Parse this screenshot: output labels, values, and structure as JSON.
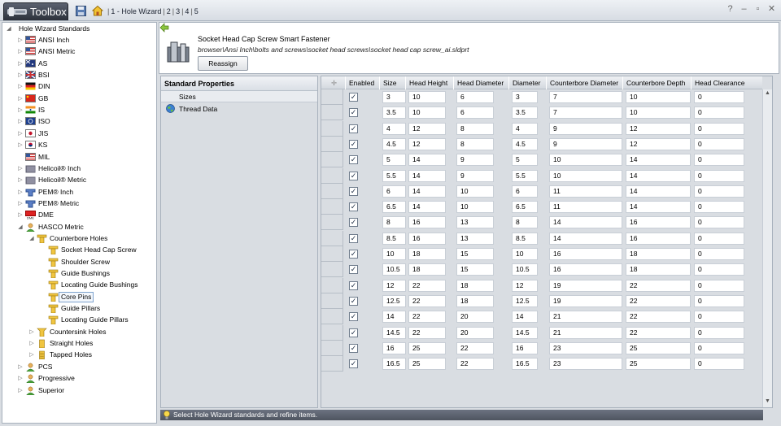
{
  "app": {
    "title": "Toolbox"
  },
  "breadcrumb": {
    "items": [
      "1 - Hole Wizard",
      "2",
      "3",
      "4",
      "5"
    ]
  },
  "window_buttons": [
    "?",
    "–",
    "▫",
    "✕"
  ],
  "tree": {
    "root": "Hole Wizard Standards",
    "nodes": [
      {
        "label": "ANSI Inch",
        "icon": "flag-usa-icon"
      },
      {
        "label": "ANSI Metric",
        "icon": "flag-usa-icon"
      },
      {
        "label": "AS",
        "icon": "flag-australia-icon"
      },
      {
        "label": "BSI",
        "icon": "flag-uk-icon"
      },
      {
        "label": "DIN",
        "icon": "flag-germany-icon"
      },
      {
        "label": "GB",
        "icon": "flag-china-icon"
      },
      {
        "label": "IS",
        "icon": "flag-india-icon"
      },
      {
        "label": "ISO",
        "icon": "flag-iso-icon"
      },
      {
        "label": "JIS",
        "icon": "flag-japan-icon"
      },
      {
        "label": "KS",
        "icon": "flag-korea-icon"
      },
      {
        "label": "MIL",
        "icon": "flag-usa-icon"
      },
      {
        "label": "Helicoil® Inch",
        "icon": "helicoil-icon"
      },
      {
        "label": "Helicoil® Metric",
        "icon": "helicoil-icon"
      },
      {
        "label": "PEM® Inch",
        "icon": "pem-icon"
      },
      {
        "label": "PEM® Metric",
        "icon": "pem-icon"
      },
      {
        "label": "DME",
        "icon": "dme-icon"
      },
      {
        "label": "HASCO Metric",
        "icon": "user-group-icon"
      },
      {
        "label": "Counterbore Holes",
        "icon": "counterbore-icon"
      },
      {
        "label": "Socket Head Cap Screw",
        "icon": "counterbore-icon"
      },
      {
        "label": "Shoulder Screw",
        "icon": "counterbore-icon"
      },
      {
        "label": "Guide Bushings",
        "icon": "counterbore-icon"
      },
      {
        "label": "Locating Guide Bushings",
        "icon": "counterbore-icon"
      },
      {
        "label": "Core Pins",
        "icon": "counterbore-icon"
      },
      {
        "label": "Guide Pillars",
        "icon": "counterbore-icon"
      },
      {
        "label": "Locating Guide Pillars",
        "icon": "counterbore-icon"
      },
      {
        "label": "Countersink Holes",
        "icon": "countersink-icon"
      },
      {
        "label": "Straight Holes",
        "icon": "straight-hole-icon"
      },
      {
        "label": "Tapped Holes",
        "icon": "tapped-hole-icon"
      },
      {
        "label": "PCS",
        "icon": "user-group-icon"
      },
      {
        "label": "Progressive",
        "icon": "user-group-icon"
      },
      {
        "label": "Superior",
        "icon": "user-group-icon"
      }
    ]
  },
  "header": {
    "title": "Socket Head Cap Screw Smart Fastener",
    "path": "browser\\Ansi Inch\\bolts and screws\\socket head screws\\socket head cap screw_ai.sldprt",
    "reassign_label": "Reassign"
  },
  "props": {
    "title": "Standard Properties",
    "items": [
      "Sizes",
      "Thread Data"
    ]
  },
  "grid": {
    "columns": [
      "Enabled",
      "Size",
      "Head Height",
      "Head Diameter",
      "Diameter",
      "Counterbore Diameter",
      "Counterbore Depth",
      "Head Clearance"
    ],
    "rows": [
      {
        "enabled": true,
        "size": "3",
        "head_height": "10",
        "head_diameter": "6",
        "diameter": "3",
        "cb_diameter": "7",
        "cb_depth": "10",
        "head_clearance": "0"
      },
      {
        "enabled": true,
        "size": "3.5",
        "head_height": "10",
        "head_diameter": "6",
        "diameter": "3.5",
        "cb_diameter": "7",
        "cb_depth": "10",
        "head_clearance": "0"
      },
      {
        "enabled": true,
        "size": "4",
        "head_height": "12",
        "head_diameter": "8",
        "diameter": "4",
        "cb_diameter": "9",
        "cb_depth": "12",
        "head_clearance": "0"
      },
      {
        "enabled": true,
        "size": "4.5",
        "head_height": "12",
        "head_diameter": "8",
        "diameter": "4.5",
        "cb_diameter": "9",
        "cb_depth": "12",
        "head_clearance": "0"
      },
      {
        "enabled": true,
        "size": "5",
        "head_height": "14",
        "head_diameter": "9",
        "diameter": "5",
        "cb_diameter": "10",
        "cb_depth": "14",
        "head_clearance": "0"
      },
      {
        "enabled": true,
        "size": "5.5",
        "head_height": "14",
        "head_diameter": "9",
        "diameter": "5.5",
        "cb_diameter": "10",
        "cb_depth": "14",
        "head_clearance": "0"
      },
      {
        "enabled": true,
        "size": "6",
        "head_height": "14",
        "head_diameter": "10",
        "diameter": "6",
        "cb_diameter": "11",
        "cb_depth": "14",
        "head_clearance": "0"
      },
      {
        "enabled": true,
        "size": "6.5",
        "head_height": "14",
        "head_diameter": "10",
        "diameter": "6.5",
        "cb_diameter": "11",
        "cb_depth": "14",
        "head_clearance": "0"
      },
      {
        "enabled": true,
        "size": "8",
        "head_height": "16",
        "head_diameter": "13",
        "diameter": "8",
        "cb_diameter": "14",
        "cb_depth": "16",
        "head_clearance": "0"
      },
      {
        "enabled": true,
        "size": "8.5",
        "head_height": "16",
        "head_diameter": "13",
        "diameter": "8.5",
        "cb_diameter": "14",
        "cb_depth": "16",
        "head_clearance": "0"
      },
      {
        "enabled": true,
        "size": "10",
        "head_height": "18",
        "head_diameter": "15",
        "diameter": "10",
        "cb_diameter": "16",
        "cb_depth": "18",
        "head_clearance": "0"
      },
      {
        "enabled": true,
        "size": "10.5",
        "head_height": "18",
        "head_diameter": "15",
        "diameter": "10.5",
        "cb_diameter": "16",
        "cb_depth": "18",
        "head_clearance": "0"
      },
      {
        "enabled": true,
        "size": "12",
        "head_height": "22",
        "head_diameter": "18",
        "diameter": "12",
        "cb_diameter": "19",
        "cb_depth": "22",
        "head_clearance": "0"
      },
      {
        "enabled": true,
        "size": "12.5",
        "head_height": "22",
        "head_diameter": "18",
        "diameter": "12.5",
        "cb_diameter": "19",
        "cb_depth": "22",
        "head_clearance": "0"
      },
      {
        "enabled": true,
        "size": "14",
        "head_height": "22",
        "head_diameter": "20",
        "diameter": "14",
        "cb_diameter": "21",
        "cb_depth": "22",
        "head_clearance": "0"
      },
      {
        "enabled": true,
        "size": "14.5",
        "head_height": "22",
        "head_diameter": "20",
        "diameter": "14.5",
        "cb_diameter": "21",
        "cb_depth": "22",
        "head_clearance": "0"
      },
      {
        "enabled": true,
        "size": "16",
        "head_height": "25",
        "head_diameter": "22",
        "diameter": "16",
        "cb_diameter": "23",
        "cb_depth": "25",
        "head_clearance": "0"
      },
      {
        "enabled": true,
        "size": "16.5",
        "head_height": "25",
        "head_diameter": "22",
        "diameter": "16.5",
        "cb_diameter": "23",
        "cb_depth": "25",
        "head_clearance": "0"
      }
    ]
  },
  "status": {
    "text": "Select Hole Wizard standards and refine items."
  }
}
